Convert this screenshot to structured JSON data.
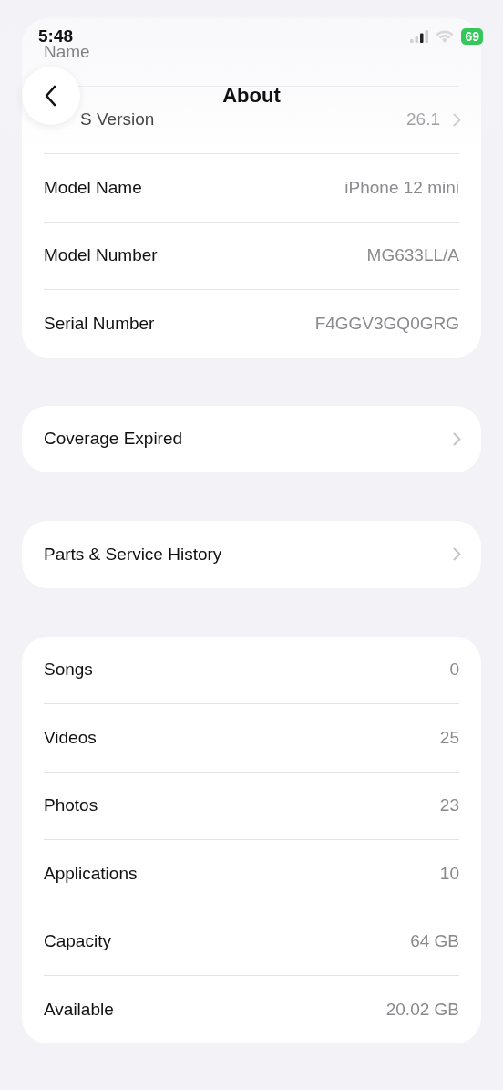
{
  "status_bar": {
    "time": "5:48",
    "battery": "69"
  },
  "nav": {
    "title": "About"
  },
  "sections": [
    {
      "rows": [
        {
          "label": "Name",
          "chevron": false
        },
        {
          "label": "S Version",
          "value": "26.1",
          "chevron": true
        },
        {
          "label": "Model Name",
          "value": "iPhone 12 mini",
          "chevron": false
        },
        {
          "label": "Model Number",
          "value": "MG633LL/A",
          "chevron": false
        },
        {
          "label": "Serial Number",
          "value": "F4GGV3GQ0GRG",
          "chevron": false
        }
      ]
    },
    {
      "rows": [
        {
          "label": "Coverage Expired",
          "chevron": true
        }
      ]
    },
    {
      "rows": [
        {
          "label": "Parts & Service History",
          "chevron": true
        }
      ]
    },
    {
      "rows": [
        {
          "label": "Songs",
          "value": "0",
          "chevron": false
        },
        {
          "label": "Videos",
          "value": "25",
          "chevron": false
        },
        {
          "label": "Photos",
          "value": "23",
          "chevron": false
        },
        {
          "label": "Applications",
          "value": "10",
          "chevron": false
        },
        {
          "label": "Capacity",
          "value": "64 GB",
          "chevron": false
        },
        {
          "label": "Available",
          "value": "20.02 GB",
          "chevron": false
        }
      ]
    }
  ]
}
